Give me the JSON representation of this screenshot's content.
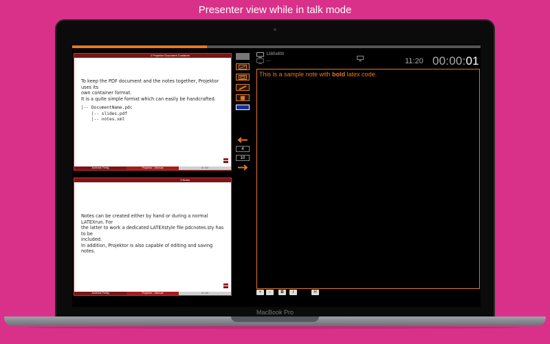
{
  "caption": "Presenter view while in talk mode",
  "device_label": "MacBook Pro",
  "progress": 0.33,
  "slide_top": {
    "header": "2 Projektor Document Container",
    "body_lines": [
      "To keep the PDF document and the notes together, Projektor uses its",
      "own container format.",
      "It is a quite simple format which can easily be handcrafted."
    ],
    "code_lines": [
      "|-- DocumentName.pdc",
      "    |-- slides.pdf",
      "    |-- notes.xml"
    ],
    "footer_author": "Andreas Fertig",
    "footer_title": "Projektor - Manual",
    "footer_page": "4 / 10"
  },
  "slide_bottom": {
    "header": "3 Notes",
    "body_lines": [
      "Notes can be created either by hand or during a normal LATEXrun. For",
      "the latter to work a dedicated LATEXstyle file pdcnotes.sty has to be",
      "included.",
      "In addition, Projektor is also capable of editing and saving notes."
    ],
    "footer_author": "Andreas Fertig",
    "footer_title": "Projektor - Manual",
    "footer_page": "5 / 10"
  },
  "tools": [
    "select-tool-icon",
    "slide-tool-icon",
    "rect-tool-icon",
    "pen-tool-icon",
    "marker-tool-icon",
    "color-swatch"
  ],
  "nav": {
    "current_slide": "4",
    "total_slides": "10"
  },
  "status": {
    "resolution": "1280x800",
    "resolution2": "----",
    "clock": "11:20",
    "timer_main": "00:00:",
    "timer_seconds": "01"
  },
  "notes": {
    "text_before": "This is a sample note with ",
    "text_bold": "bold",
    "text_after": " latex code."
  },
  "format_buttons": {
    "increase": "+",
    "decrease": "-",
    "bold": "B",
    "italic": "I",
    "heading": "H"
  },
  "colors": {
    "background": "#d9318a",
    "accent": "#e8781f",
    "slide_frame": "#7a1515",
    "swatch": "#1a2f9c"
  }
}
